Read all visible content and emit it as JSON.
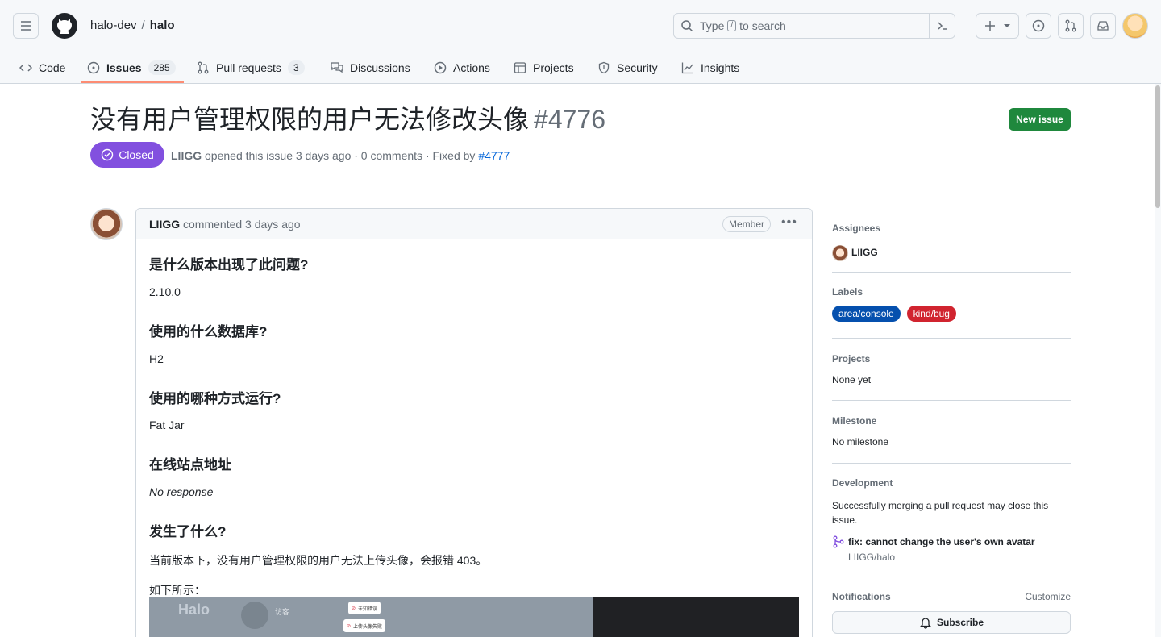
{
  "header": {
    "owner": "halo-dev",
    "separator": "/",
    "repo": "halo",
    "search_prefix": "Type",
    "search_key": "/",
    "search_suffix": "to search"
  },
  "tabs": [
    {
      "label": "Code",
      "icon": "code-icon"
    },
    {
      "label": "Issues",
      "icon": "issue-opened-icon",
      "count": "285"
    },
    {
      "label": "Pull requests",
      "icon": "git-pull-request-icon",
      "count": "3"
    },
    {
      "label": "Discussions",
      "icon": "comment-discussion-icon"
    },
    {
      "label": "Actions",
      "icon": "play-icon"
    },
    {
      "label": "Projects",
      "icon": "table-icon"
    },
    {
      "label": "Security",
      "icon": "shield-icon"
    },
    {
      "label": "Insights",
      "icon": "graph-icon"
    }
  ],
  "issue": {
    "title": "没有用户管理权限的用户无法修改头像",
    "number": "#4776",
    "state": "Closed",
    "author": "LIIGG",
    "meta_opened": "opened this issue 3 days ago · 0 comments · Fixed by",
    "fixed_by": "#4777",
    "new_issue_label": "New issue"
  },
  "comment": {
    "author": "LIIGG",
    "time": "commented 3 days ago",
    "badge": "Member",
    "sections": [
      {
        "heading": "是什么版本出现了此问题?",
        "value": "2.10.0"
      },
      {
        "heading": "使用的什么数据库?",
        "value": "H2"
      },
      {
        "heading": "使用的哪种方式运行?",
        "value": "Fat Jar"
      },
      {
        "heading": "在线站点地址",
        "value": "No response"
      },
      {
        "heading": "发生了什么?",
        "value": "当前版本下，没有用户管理权限的用户无法上传头像，会报错 403。"
      }
    ],
    "follow": "如下所示：",
    "screenshot": {
      "logo": "Halo",
      "visitor": "访客",
      "toast1": "未知错误",
      "toast2": "上传头像失败"
    }
  },
  "sidebar": {
    "assignees_label": "Assignees",
    "assignee": "LIIGG",
    "labels_label": "Labels",
    "labels": [
      {
        "name": "area/console",
        "color": "#0550ae"
      },
      {
        "name": "kind/bug",
        "color": "#d1242f"
      }
    ],
    "projects_label": "Projects",
    "projects_value": "None yet",
    "milestone_label": "Milestone",
    "milestone_value": "No milestone",
    "development_label": "Development",
    "development_text": "Successfully merging a pull request may close this issue.",
    "pr_title": "fix: cannot change the user's own avatar",
    "pr_repo": "LIIGG/halo",
    "notifications_label": "Notifications",
    "customize_label": "Customize",
    "subscribe_label": "Subscribe"
  },
  "colors": {
    "accent": "#0969da",
    "closed": "#8250df",
    "success": "#1f883d",
    "tab_underline": "#fd8c73"
  }
}
